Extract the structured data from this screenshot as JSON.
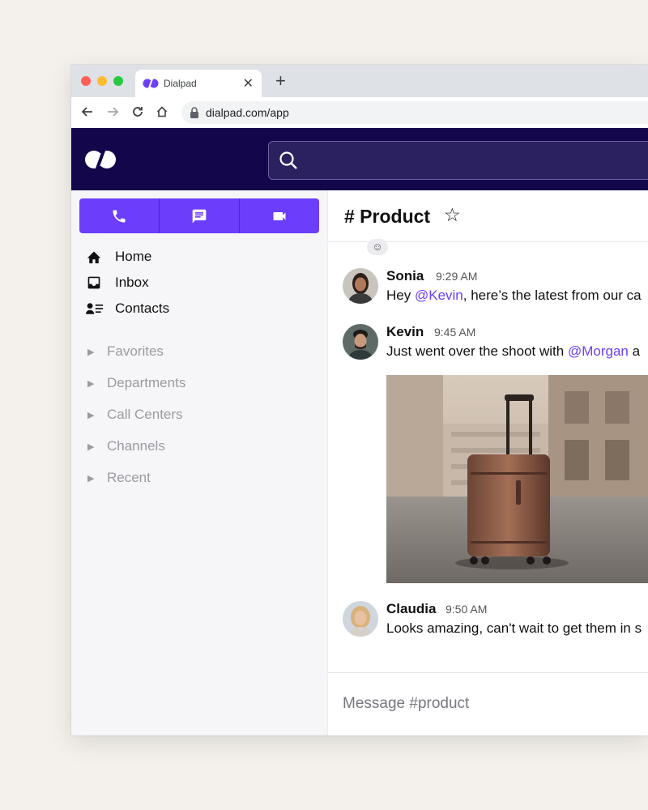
{
  "browser": {
    "tab_title": "Dialpad",
    "tab_close": "✕",
    "new_tab": "+",
    "url": "dialpad.com/app"
  },
  "app": {
    "colors": {
      "header_bg": "#14064a",
      "accent": "#6c3dfb",
      "sidebar_bg": "#f6f6f8"
    },
    "search": {
      "placeholder": ""
    },
    "action_buttons": [
      {
        "icon": "phone-icon"
      },
      {
        "icon": "message-icon"
      },
      {
        "icon": "video-icon"
      }
    ],
    "nav": [
      {
        "label": "Home",
        "icon": "home-icon"
      },
      {
        "label": "Inbox",
        "icon": "inbox-icon"
      },
      {
        "label": "Contacts",
        "icon": "contacts-icon"
      }
    ],
    "sections": [
      {
        "label": "Favorites"
      },
      {
        "label": "Departments"
      },
      {
        "label": "Call Centers"
      },
      {
        "label": "Channels"
      },
      {
        "label": "Recent"
      }
    ]
  },
  "channel": {
    "name": "# Product",
    "star": "☆",
    "reaction": "☺"
  },
  "messages": [
    {
      "author": "Sonia",
      "time": "9:29 AM",
      "text_before": "Hey ",
      "mention": "@Kevin",
      "text_after": ", here’s the latest from our ca"
    },
    {
      "author": "Kevin",
      "time": "9:45 AM",
      "text_before": "Just went over the shoot with ",
      "mention": "@Morgan",
      "text_after": " a"
    },
    {
      "author": "Claudia",
      "time": "9:50 AM",
      "text": "Looks amazing, can't wait to get them in s"
    }
  ],
  "composer": {
    "placeholder": "Message #product"
  }
}
